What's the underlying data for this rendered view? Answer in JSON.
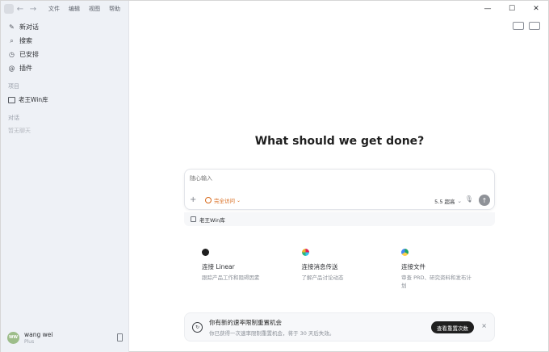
{
  "menu": [
    "文件",
    "编辑",
    "视图",
    "帮助"
  ],
  "nav": {
    "back": "←",
    "forward": "→"
  },
  "window_controls": {
    "minimize": "—",
    "maximize": "☐",
    "close": "✕"
  },
  "sidebar": {
    "items": [
      {
        "label": "新对话",
        "icon": "edit-icon"
      },
      {
        "label": "搜索",
        "icon": "search-icon"
      },
      {
        "label": "已安排",
        "icon": "clock-icon"
      },
      {
        "label": "插件",
        "icon": "plugin-icon"
      }
    ],
    "projects_label": "项目",
    "projects": [
      {
        "label": "老王Win库",
        "icon": "folder-icon"
      }
    ],
    "conversations_label": "对话",
    "empty_conversations": "暂无聊天"
  },
  "user": {
    "name": "wang wei",
    "plan": "Plus",
    "initials": "WW"
  },
  "main": {
    "heading": "What should we get done?",
    "composer": {
      "placeholder": "随心输入",
      "access_label": "完全访问",
      "model_label": "5.5 超高",
      "plus": "+",
      "send": "↑",
      "mic": "🎙"
    },
    "repo_label": "老王Win库",
    "cards": [
      {
        "title": "连接 Linear",
        "desc": "跟踪产品工作和阻碍因素",
        "icon": "linear-icon"
      },
      {
        "title": "连接消息传送",
        "desc": "了解产品讨论动态",
        "icon": "slack-icon"
      },
      {
        "title": "连接文件",
        "desc": "审查 PRD、研究资料和发布计划",
        "icon": "drive-icon"
      }
    ],
    "banner": {
      "title": "你有新的速率限制重置机会",
      "desc": "你已获得一次速率限制重置机会，将于 30 天后失效。",
      "button": "查看重置次数",
      "close": "×"
    }
  }
}
